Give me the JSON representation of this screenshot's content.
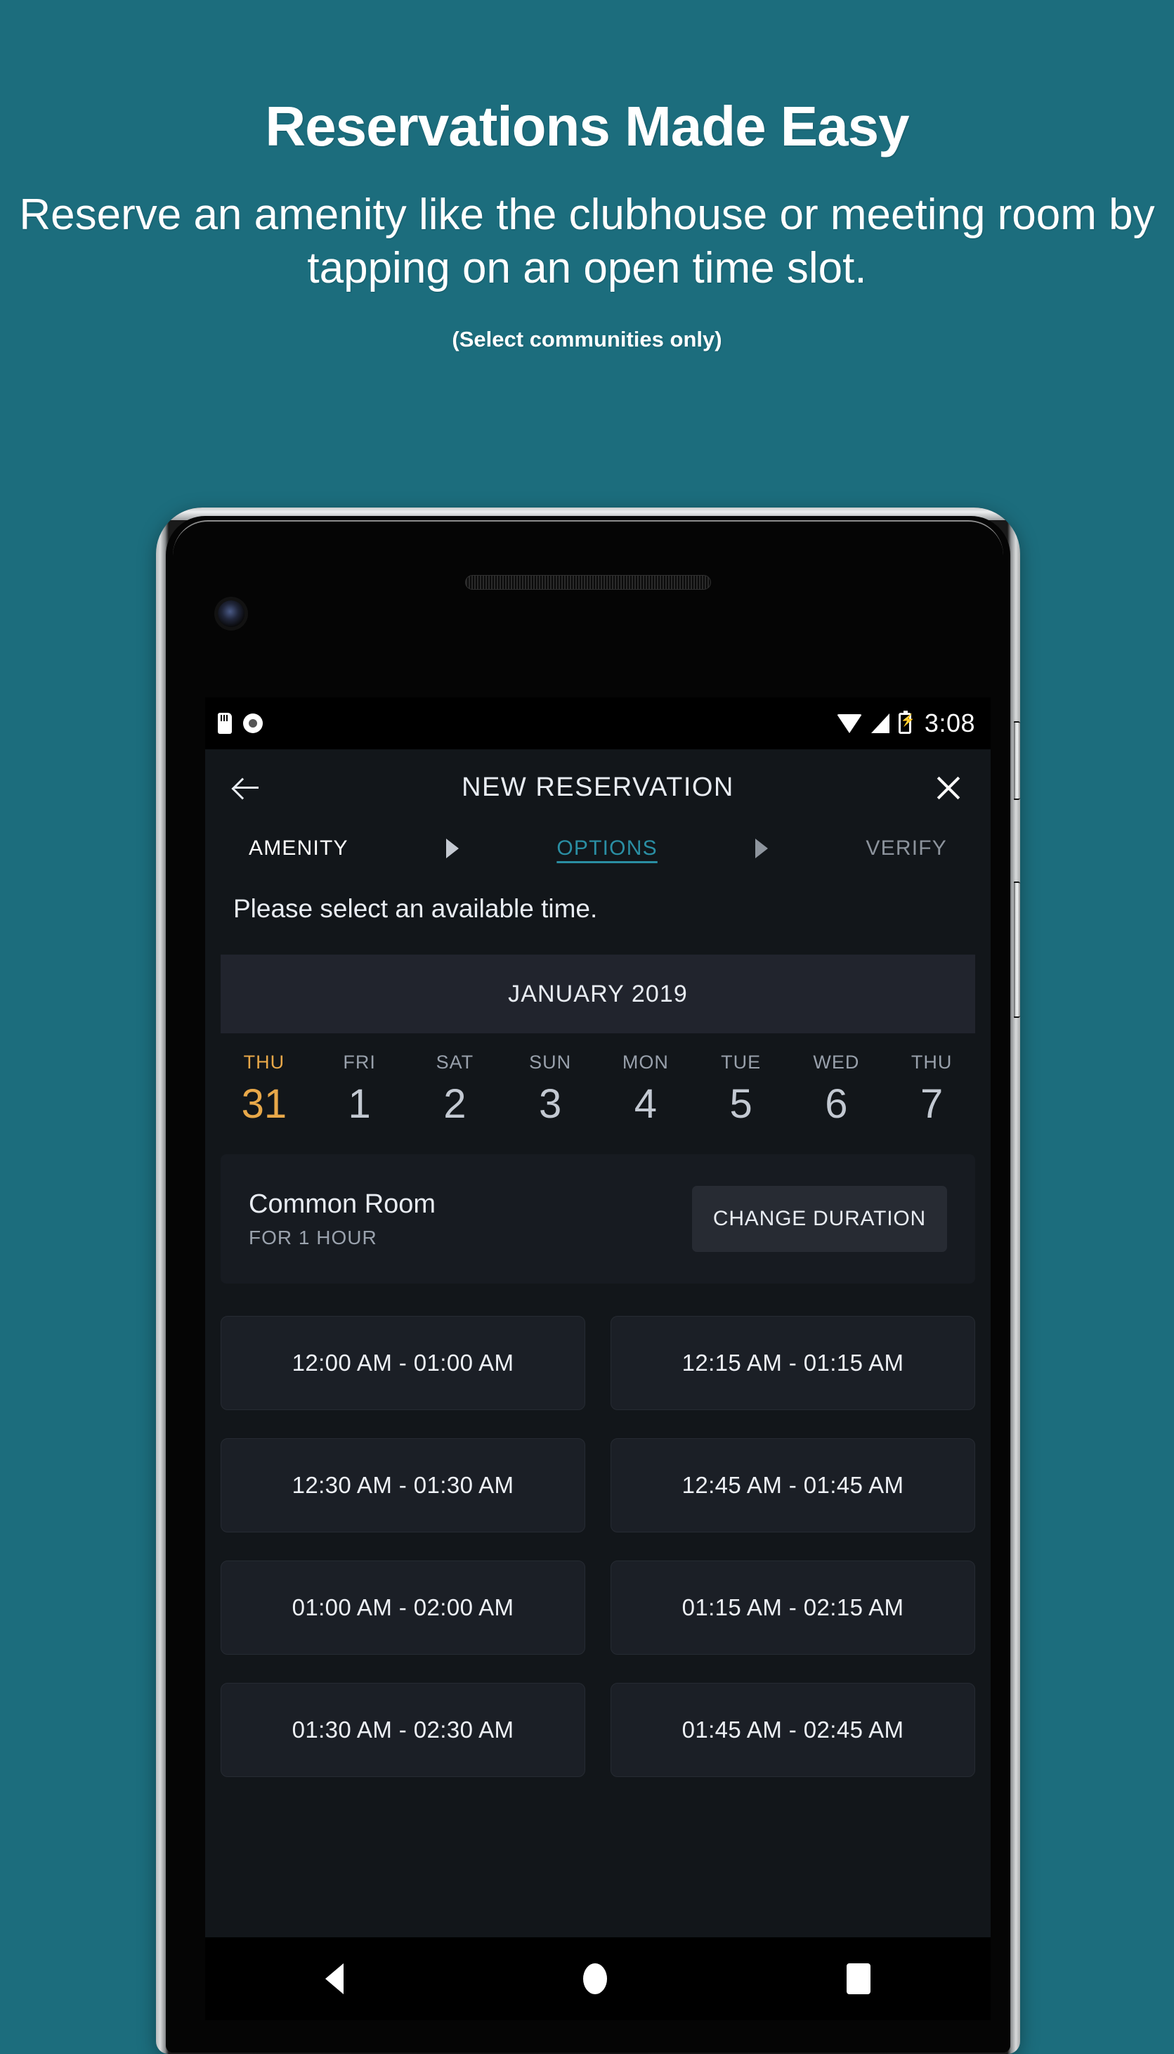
{
  "promo": {
    "title": "Reservations Made Easy",
    "subtitle": "Reserve an amenity like the clubhouse or meeting room by tapping on an open time slot.",
    "note": "(Select communities only)",
    "background_color": "#1c6d7d"
  },
  "statusbar": {
    "time": "3:08",
    "icons": [
      "sdcard-icon",
      "record-icon",
      "wifi-icon",
      "signal-icon",
      "battery-charging-icon"
    ]
  },
  "appbar": {
    "title": "NEW RESERVATION",
    "back_icon": "back-arrow-icon",
    "close_icon": "close-icon"
  },
  "stepper": {
    "steps": [
      {
        "label": "AMENITY",
        "state": "done"
      },
      {
        "label": "OPTIONS",
        "state": "active"
      },
      {
        "label": "VERIFY",
        "state": "future"
      }
    ],
    "active_color": "#2a8ea3"
  },
  "instruction": "Please select an available time.",
  "calendar": {
    "month_label": "JANUARY 2019",
    "selected_color": "#e8a849",
    "days": [
      {
        "dow": "THU",
        "num": "31",
        "selected": true
      },
      {
        "dow": "FRI",
        "num": "1",
        "selected": false
      },
      {
        "dow": "SAT",
        "num": "2",
        "selected": false
      },
      {
        "dow": "SUN",
        "num": "3",
        "selected": false
      },
      {
        "dow": "MON",
        "num": "4",
        "selected": false
      },
      {
        "dow": "TUE",
        "num": "5",
        "selected": false
      },
      {
        "dow": "WED",
        "num": "6",
        "selected": false
      },
      {
        "dow": "THU",
        "num": "7",
        "selected": false
      }
    ]
  },
  "amenity": {
    "name": "Common Room",
    "duration": "FOR 1 HOUR",
    "change_button": "CHANGE DURATION"
  },
  "time_slots": [
    "12:00 AM - 01:00 AM",
    "12:15 AM - 01:15 AM",
    "12:30 AM - 01:30 AM",
    "12:45 AM - 01:45 AM",
    "01:00 AM - 02:00 AM",
    "01:15 AM - 02:15 AM",
    "01:30 AM - 02:30 AM",
    "01:45 AM - 02:45 AM"
  ],
  "navbar": {
    "back": "nav-back-icon",
    "home": "nav-home-icon",
    "recent": "nav-recent-icon"
  }
}
